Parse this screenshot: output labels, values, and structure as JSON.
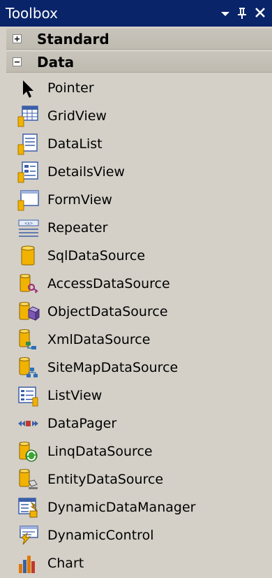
{
  "window": {
    "title": "Toolbox"
  },
  "groups": [
    {
      "label": "Standard",
      "state": "collapsed",
      "toggle_icon": "plus-icon"
    },
    {
      "label": "Data",
      "state": "expanded",
      "toggle_icon": "minus-icon"
    }
  ],
  "items": [
    {
      "label": "Pointer",
      "icon": "pointer-arrow-icon"
    },
    {
      "label": "GridView",
      "icon": "gridview-icon"
    },
    {
      "label": "DataList",
      "icon": "datalist-icon"
    },
    {
      "label": "DetailsView",
      "icon": "detailsview-icon"
    },
    {
      "label": "FormView",
      "icon": "formview-icon"
    },
    {
      "label": "Repeater",
      "icon": "repeater-icon"
    },
    {
      "label": "SqlDataSource",
      "icon": "sqldatasource-icon"
    },
    {
      "label": "AccessDataSource",
      "icon": "accessdatasource-icon"
    },
    {
      "label": "ObjectDataSource",
      "icon": "objectdatasource-icon"
    },
    {
      "label": "XmlDataSource",
      "icon": "xmldatasource-icon"
    },
    {
      "label": "SiteMapDataSource",
      "icon": "sitemapdatasource-icon"
    },
    {
      "label": "ListView",
      "icon": "listview-icon"
    },
    {
      "label": "DataPager",
      "icon": "datapager-icon"
    },
    {
      "label": "LinqDataSource",
      "icon": "linqdatasource-icon"
    },
    {
      "label": "EntityDataSource",
      "icon": "entitydatasource-icon"
    },
    {
      "label": "DynamicDataManager",
      "icon": "dynamicdatamanager-icon"
    },
    {
      "label": "DynamicControl",
      "icon": "dynamiccontrol-icon"
    },
    {
      "label": "Chart",
      "icon": "chart-icon"
    }
  ]
}
